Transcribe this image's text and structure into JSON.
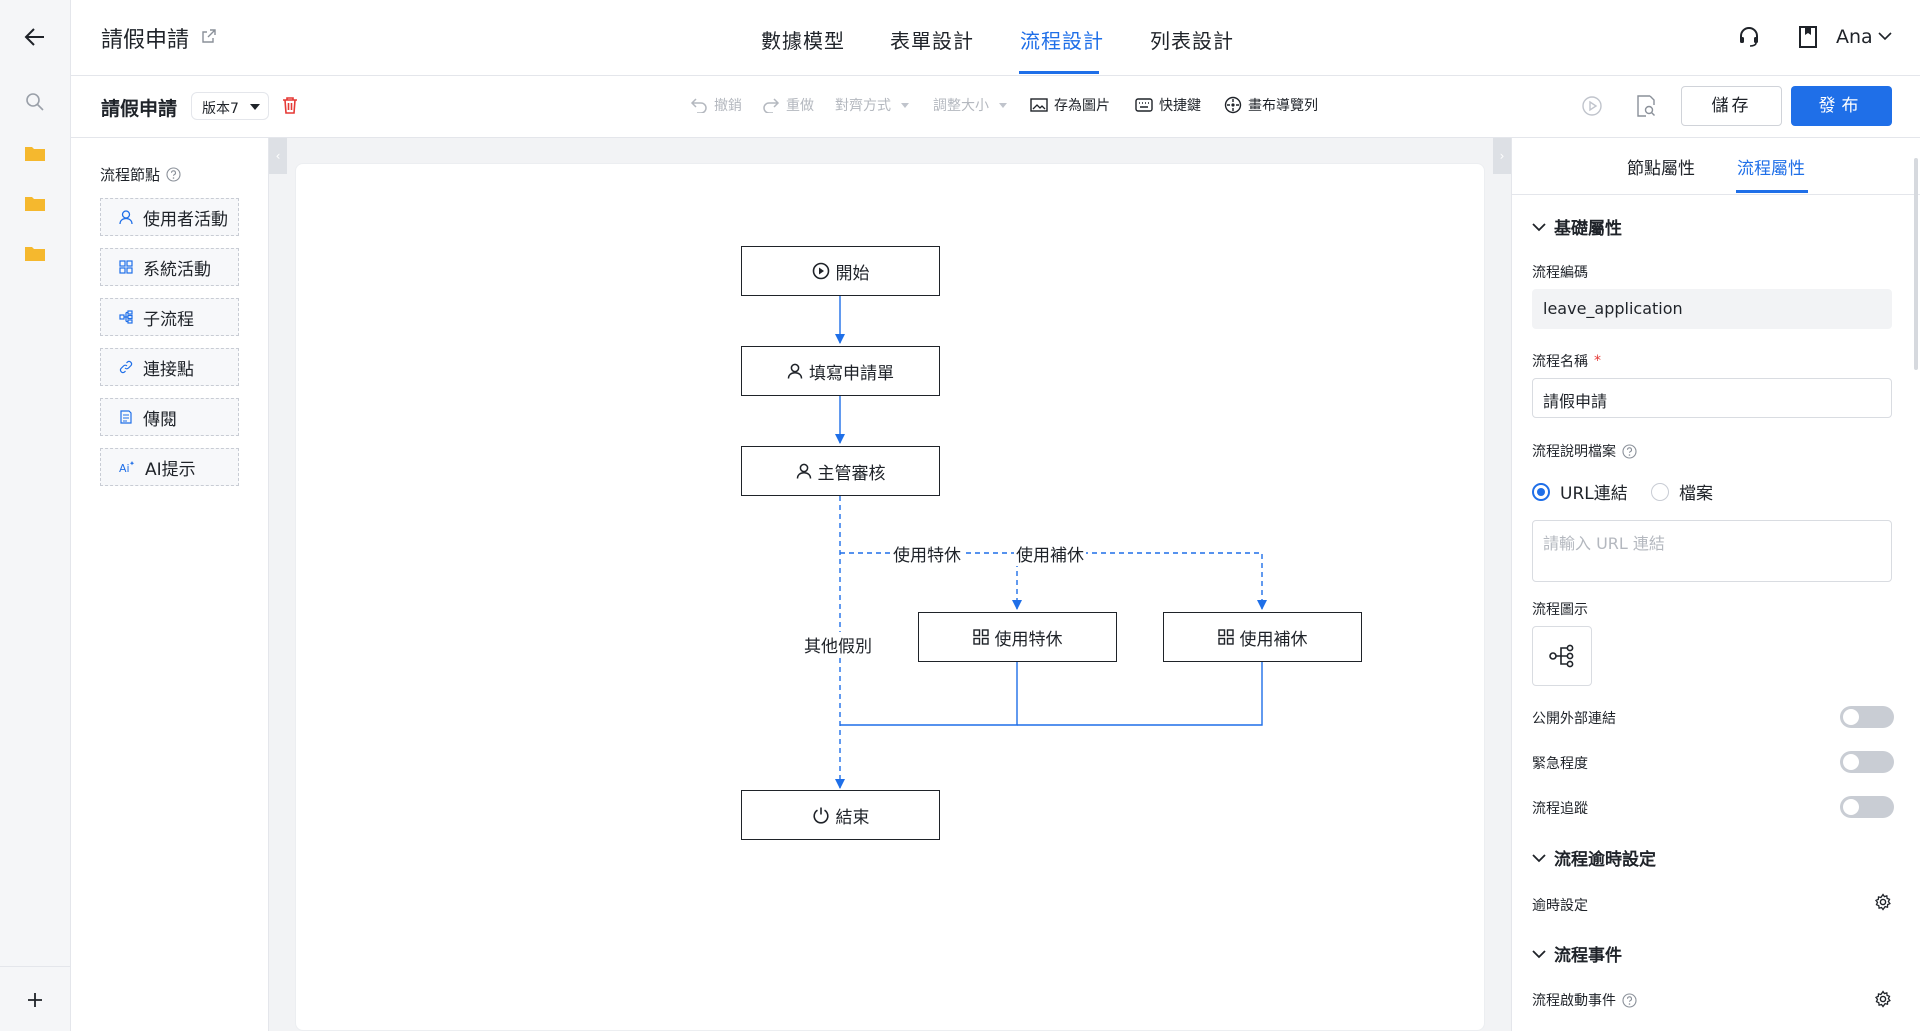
{
  "app": {
    "title": "請假申請"
  },
  "header": {
    "tabs": [
      {
        "label": "數據模型",
        "active": false
      },
      {
        "label": "表單設計",
        "active": false
      },
      {
        "label": "流程設計",
        "active": true
      },
      {
        "label": "列表設計",
        "active": false
      }
    ],
    "user": "Ana",
    "accent_color": "#1f6fe8"
  },
  "toolbar": {
    "flow_name": "請假申請",
    "version": "版本7",
    "undo": "撤銷",
    "redo": "重做",
    "align": "對齊方式",
    "resize": "調整大小",
    "save_image": "存為圖片",
    "shortcuts": "快捷鍵",
    "minimap": "畫布導覽列",
    "save": "儲存",
    "publish": "發布"
  },
  "palette": {
    "title": "流程節點",
    "items": [
      {
        "label": "使用者活動",
        "icon": "user-icon"
      },
      {
        "label": "系統活動",
        "icon": "grid-icon"
      },
      {
        "label": "子流程",
        "icon": "subflow-icon"
      },
      {
        "label": "連接點",
        "icon": "link-icon"
      },
      {
        "label": "傳閱",
        "icon": "document-icon"
      },
      {
        "label": "AI提示",
        "icon": "ai-icon"
      }
    ]
  },
  "flow": {
    "nodes": {
      "start": "開始",
      "fill_form": "填寫申請單",
      "manager_review": "主管審核",
      "special_leave": "使用特休",
      "comp_leave": "使用補休",
      "end": "結束"
    },
    "edges": {
      "special_leave": "使用特休",
      "comp_leave": "使用補休",
      "other": "其他假別"
    }
  },
  "properties": {
    "tabs": [
      {
        "label": "節點屬性",
        "active": false
      },
      {
        "label": "流程屬性",
        "active": true
      }
    ],
    "basic": {
      "title": "基礎屬性",
      "code_label": "流程編碼",
      "code_value": "leave_application",
      "name_label": "流程名稱",
      "required_mark": "*",
      "name_value": "請假申請",
      "doc_label": "流程說明檔案",
      "radio_url": "URL連結",
      "radio_file": "檔案",
      "url_placeholder": "請輸入 URL 連結",
      "icon_label": "流程圖示",
      "public_link": "公開外部連結",
      "public_link_on": false,
      "urgency": "緊急程度",
      "urgency_on": false,
      "tracking": "流程追蹤",
      "tracking_on": false
    },
    "timeout": {
      "title": "流程逾時設定",
      "setting_label": "逾時設定"
    },
    "events": {
      "title": "流程事件",
      "start_event_label": "流程啟動事件"
    }
  }
}
